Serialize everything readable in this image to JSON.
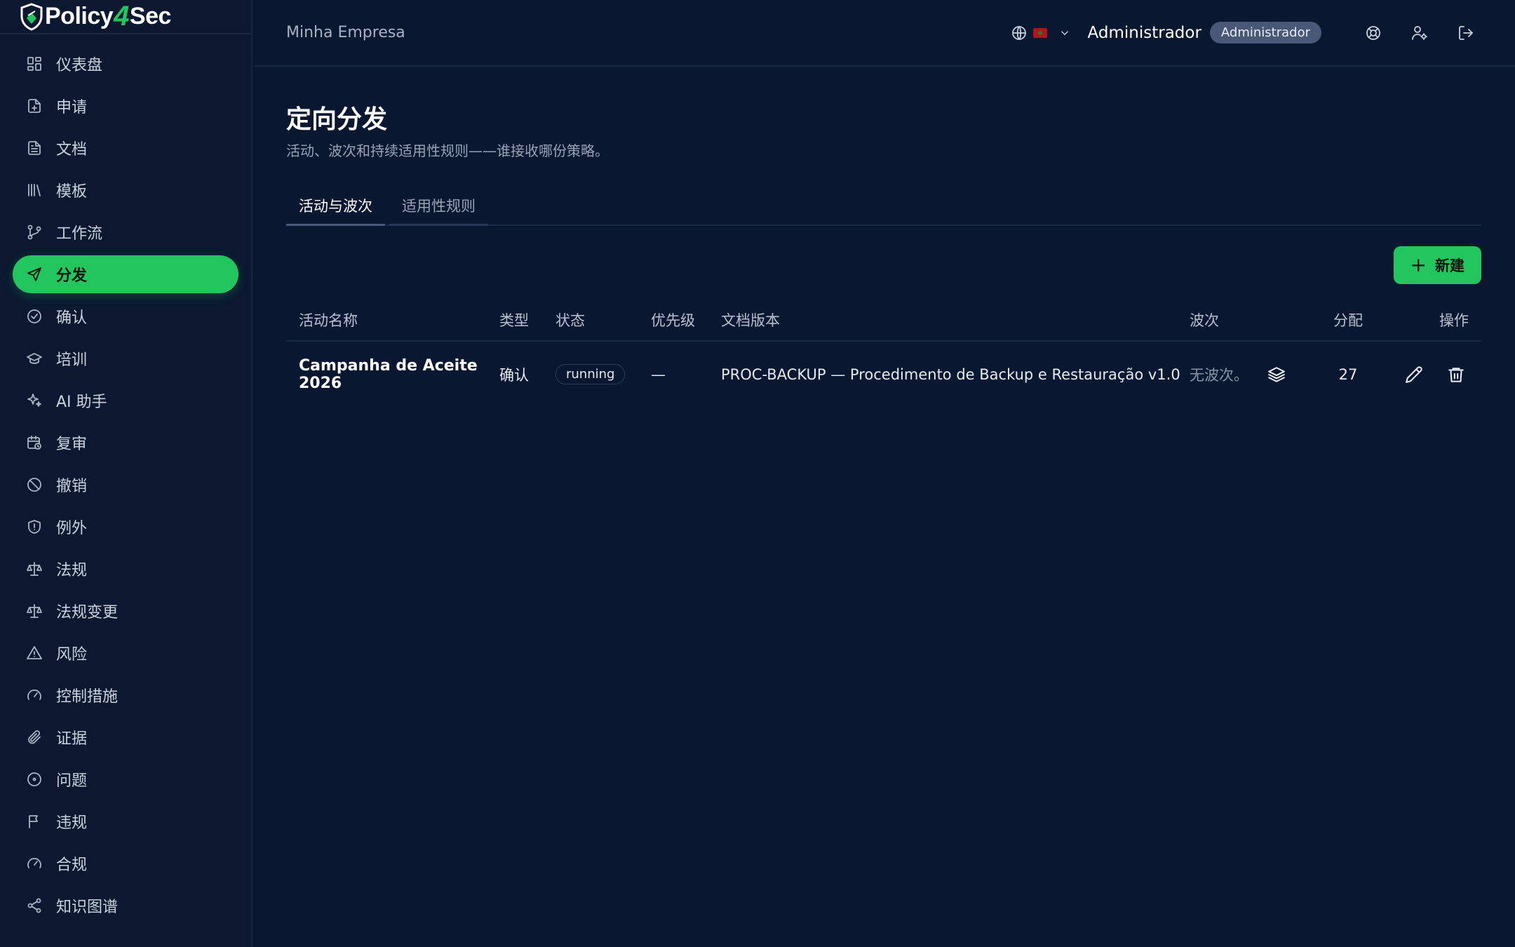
{
  "brand": {
    "name_part1": "Policy",
    "name_part2": "4",
    "name_part3": "Sec",
    "accent": "#22c55e"
  },
  "sidebar": {
    "items": [
      {
        "label": "仪表盘",
        "icon": "dashboard-icon"
      },
      {
        "label": "申请",
        "icon": "file-plus-icon"
      },
      {
        "label": "文档",
        "icon": "document-icon"
      },
      {
        "label": "模板",
        "icon": "library-icon"
      },
      {
        "label": "工作流",
        "icon": "git-branch-icon"
      },
      {
        "label": "分发",
        "icon": "send-icon",
        "active": true
      },
      {
        "label": "确认",
        "icon": "check-circle-icon"
      },
      {
        "label": "培训",
        "icon": "graduation-cap-icon"
      },
      {
        "label": "AI 助手",
        "icon": "sparkles-icon"
      },
      {
        "label": "复审",
        "icon": "calendar-clock-icon"
      },
      {
        "label": "撤销",
        "icon": "ban-icon"
      },
      {
        "label": "例外",
        "icon": "shield-alert-icon"
      },
      {
        "label": "法规",
        "icon": "scale-icon"
      },
      {
        "label": "法规变更",
        "icon": "scale-icon"
      },
      {
        "label": "风险",
        "icon": "warning-icon"
      },
      {
        "label": "控制措施",
        "icon": "gauge-icon"
      },
      {
        "label": "证据",
        "icon": "paperclip-icon"
      },
      {
        "label": "问题",
        "icon": "circle-dot-icon"
      },
      {
        "label": "违规",
        "icon": "flag-icon"
      },
      {
        "label": "合规",
        "icon": "gauge-icon"
      },
      {
        "label": "知识图谱",
        "icon": "share-icon"
      }
    ]
  },
  "header": {
    "company": "Minha Empresa",
    "user_name": "Administrador",
    "role_badge": "Administrador"
  },
  "page": {
    "title": "定向分发",
    "subtitle": "活动、波次和持续适用性规则——谁接收哪份策略。"
  },
  "tabs": [
    {
      "label": "活动与波次",
      "active": true
    },
    {
      "label": "适用性规则",
      "active": false
    }
  ],
  "toolbar": {
    "new_label": "新建"
  },
  "table": {
    "headers": {
      "name": "活动名称",
      "type": "类型",
      "status": "状态",
      "priority": "优先级",
      "doc_version": "文档版本",
      "waves": "波次",
      "allocations": "分配",
      "actions": "操作"
    },
    "rows": [
      {
        "name": "Campanha de Aceite 2026",
        "type": "确认",
        "status": "running",
        "priority": "—",
        "doc_version": "PROC-BACKUP — Procedimento de Backup e Restauração v1.0",
        "waves": "无波次。",
        "allocations": "27"
      }
    ]
  }
}
